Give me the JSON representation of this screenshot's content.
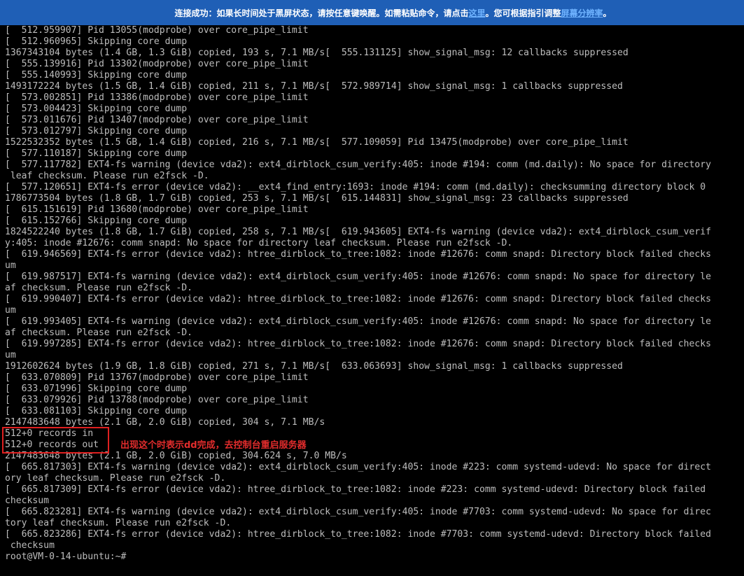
{
  "banner": {
    "text_before": "连接成功：如果长时间处于黑屏状态，请按任意键唤醒。如需粘贴命令，请点击",
    "link1": "这里",
    "text_middle": "。您可根据指引调整",
    "link2": "屏幕分辨率",
    "text_after": "。"
  },
  "terminal": {
    "lines": [
      "[  512.959907] Pid 13055(modprobe) over core_pipe_limit",
      "[  512.960965] Skipping core dump",
      "1367343104 bytes (1.4 GB, 1.3 GiB) copied, 193 s, 7.1 MB/s[  555.131125] show_signal_msg: 12 callbacks suppressed",
      "[  555.139916] Pid 13302(modprobe) over core_pipe_limit",
      "[  555.140993] Skipping core dump",
      "1493172224 bytes (1.5 GB, 1.4 GiB) copied, 211 s, 7.1 MB/s[  572.989714] show_signal_msg: 1 callbacks suppressed",
      "[  573.002851] Pid 13386(modprobe) over core_pipe_limit",
      "[  573.004423] Skipping core dump",
      "[  573.011676] Pid 13407(modprobe) over core_pipe_limit",
      "[  573.012797] Skipping core dump",
      "1522532352 bytes (1.5 GB, 1.4 GiB) copied, 216 s, 7.1 MB/s[  577.109059] Pid 13475(modprobe) over core_pipe_limit",
      "[  577.110187] Skipping core dump",
      "[  577.117782] EXT4-fs warning (device vda2): ext4_dirblock_csum_verify:405: inode #194: comm (md.daily): No space for directory",
      " leaf checksum. Please run e2fsck -D.",
      "[  577.120651] EXT4-fs error (device vda2): __ext4_find_entry:1693: inode #194: comm (md.daily): checksumming directory block 0",
      "1786773504 bytes (1.8 GB, 1.7 GiB) copied, 253 s, 7.1 MB/s[  615.144831] show_signal_msg: 23 callbacks suppressed",
      "[  615.151619] Pid 13680(modprobe) over core_pipe_limit",
      "[  615.152766] Skipping core dump",
      "1824522240 bytes (1.8 GB, 1.7 GiB) copied, 258 s, 7.1 MB/s[  619.943605] EXT4-fs warning (device vda2): ext4_dirblock_csum_verif",
      "y:405: inode #12676: comm snapd: No space for directory leaf checksum. Please run e2fsck -D.",
      "[  619.946569] EXT4-fs error (device vda2): htree_dirblock_to_tree:1082: inode #12676: comm snapd: Directory block failed checks",
      "um",
      "[  619.987517] EXT4-fs warning (device vda2): ext4_dirblock_csum_verify:405: inode #12676: comm snapd: No space for directory le",
      "af checksum. Please run e2fsck -D.",
      "[  619.990407] EXT4-fs error (device vda2): htree_dirblock_to_tree:1082: inode #12676: comm snapd: Directory block failed checks",
      "um",
      "[  619.993405] EXT4-fs warning (device vda2): ext4_dirblock_csum_verify:405: inode #12676: comm snapd: No space for directory le",
      "af checksum. Please run e2fsck -D.",
      "[  619.997285] EXT4-fs error (device vda2): htree_dirblock_to_tree:1082: inode #12676: comm snapd: Directory block failed checks",
      "um",
      "1912602624 bytes (1.9 GB, 1.8 GiB) copied, 271 s, 7.1 MB/s[  633.063693] show_signal_msg: 1 callbacks suppressed",
      "[  633.070809] Pid 13767(modprobe) over core_pipe_limit",
      "[  633.071996] Skipping core dump",
      "[  633.079926] Pid 13788(modprobe) over core_pipe_limit",
      "[  633.081103] Skipping core dump",
      "2147483648 bytes (2.1 GB, 2.0 GiB) copied, 304 s, 7.1 MB/s",
      "512+0 records in",
      "512+0 records out",
      "2147483648 bytes (2.1 GB, 2.0 GiB) copied, 304.624 s, 7.0 MB/s",
      "[  665.817303] EXT4-fs warning (device vda2): ext4_dirblock_csum_verify:405: inode #223: comm systemd-udevd: No space for direct",
      "ory leaf checksum. Please run e2fsck -D.",
      "[  665.817309] EXT4-fs error (device vda2): htree_dirblock_to_tree:1082: inode #223: comm systemd-udevd: Directory block failed",
      "checksum",
      "[  665.823281] EXT4-fs warning (device vda2): ext4_dirblock_csum_verify:405: inode #7703: comm systemd-udevd: No space for direc",
      "tory leaf checksum. Please run e2fsck -D.",
      "[  665.823286] EXT4-fs error (device vda2): htree_dirblock_to_tree:1082: inode #7703: comm systemd-udevd: Directory block failed",
      " checksum",
      "root@VM-0-14-ubuntu:~#"
    ]
  },
  "annotation": {
    "text": "出现这个时表示dd完成，去控制台重启服务器"
  },
  "colors": {
    "banner_bg": "#1f5fb6",
    "terminal_bg": "#000000",
    "terminal_fg": "#bdbdbd",
    "annotation": "#e22c2c",
    "highlight_border": "#e02020"
  }
}
